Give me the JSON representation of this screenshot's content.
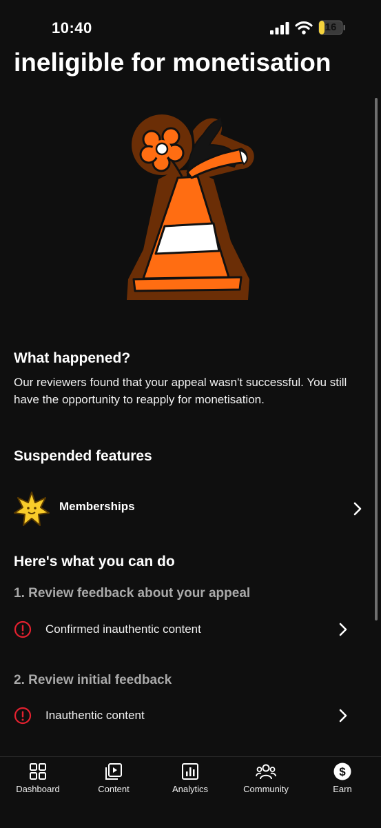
{
  "status_bar": {
    "time": "10:40",
    "battery": "16"
  },
  "page": {
    "title": "ineligible for monetisation"
  },
  "what_happened": {
    "heading": "What happened?",
    "body": "Our reviewers found that your appeal wasn't successful. You still have the opportunity to reapply for monetisation."
  },
  "suspended_features": {
    "heading": "Suspended features",
    "items": [
      {
        "label": "Memberships",
        "icon": "star-badge-icon"
      }
    ]
  },
  "what_you_can_do": {
    "heading": "Here's what you can do",
    "steps": [
      {
        "heading": "1. Review feedback about your appeal",
        "items": [
          {
            "label": "Confirmed inauthentic content",
            "icon": "alert-circle-icon"
          }
        ]
      },
      {
        "heading": "2. Review initial feedback",
        "items": [
          {
            "label": "Inauthentic content",
            "icon": "alert-circle-icon"
          }
        ]
      }
    ]
  },
  "bottom_nav": {
    "items": [
      {
        "label": "Dashboard",
        "icon": "dashboard-icon"
      },
      {
        "label": "Content",
        "icon": "content-icon"
      },
      {
        "label": "Analytics",
        "icon": "analytics-icon"
      },
      {
        "label": "Community",
        "icon": "community-icon"
      },
      {
        "label": "Earn",
        "icon": "earn-icon"
      }
    ]
  },
  "colors": {
    "background": "#0f0f0f",
    "alert": "#e3212f",
    "cone_orange": "#ff6d12",
    "cone_outline": "#6b2e06",
    "battery_yellow": "#f5d33c",
    "secondary_text": "#aaaaaa"
  }
}
